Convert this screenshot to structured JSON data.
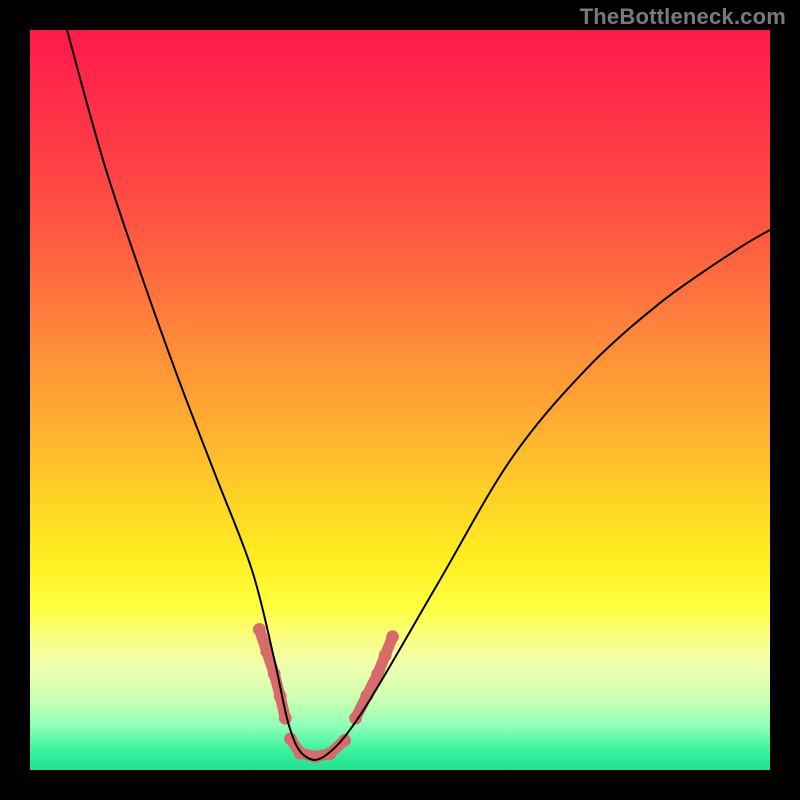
{
  "watermark": "TheBottleneck.com",
  "chart_data": {
    "type": "line",
    "title": "",
    "xlabel": "",
    "ylabel": "",
    "xlim": [
      0,
      100
    ],
    "ylim": [
      0,
      100
    ],
    "grid": false,
    "series": [
      {
        "name": "curve",
        "color": "#000000",
        "stroke_width": 2,
        "x": [
          5,
          10,
          15,
          20,
          25,
          30,
          33,
          35,
          37,
          40,
          45,
          55,
          65,
          75,
          85,
          95,
          100
        ],
        "values": [
          100,
          82,
          67,
          53,
          40,
          27,
          15,
          6,
          2,
          2,
          8,
          25,
          42,
          54,
          63,
          70,
          73
        ]
      }
    ],
    "highlight_segments": [
      {
        "name": "left-descending-highlight",
        "color": "#d86a6a",
        "stroke_width": 11,
        "points": [
          {
            "x": 31.0,
            "y": 19.0
          },
          {
            "x": 32.0,
            "y": 16.0
          },
          {
            "x": 33.0,
            "y": 13.0
          },
          {
            "x": 33.8,
            "y": 10.0
          },
          {
            "x": 34.5,
            "y": 7.0
          }
        ]
      },
      {
        "name": "valley-highlight",
        "color": "#d86a6a",
        "stroke_width": 11,
        "points": [
          {
            "x": 35.2,
            "y": 4.2
          },
          {
            "x": 36.5,
            "y": 2.3
          },
          {
            "x": 38.5,
            "y": 1.8
          },
          {
            "x": 40.5,
            "y": 2.2
          },
          {
            "x": 42.5,
            "y": 4.0
          }
        ]
      },
      {
        "name": "right-ascending-highlight",
        "color": "#d86a6a",
        "stroke_width": 11,
        "points": [
          {
            "x": 44.0,
            "y": 7.0
          },
          {
            "x": 45.5,
            "y": 10.0
          },
          {
            "x": 47.0,
            "y": 13.0
          },
          {
            "x": 48.0,
            "y": 15.5
          },
          {
            "x": 49.0,
            "y": 18.0
          }
        ]
      }
    ]
  }
}
